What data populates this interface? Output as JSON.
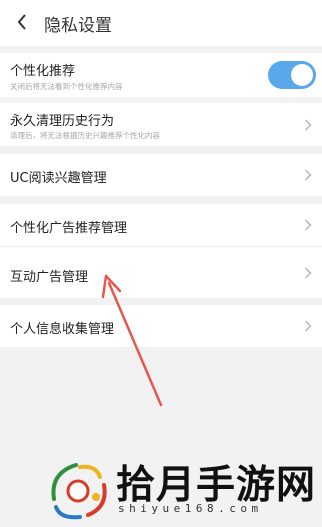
{
  "header": {
    "title": "隐私设置",
    "back_icon": "chevron-left-icon"
  },
  "settings": {
    "personalized_recommend": {
      "label": "个性化推荐",
      "description": "关闭后将无法看到个性化推荐内容",
      "toggle_on": true
    },
    "clear_history": {
      "label": "永久清理历史行为",
      "description": "清理后，将无法根据历史兴趣推荐个性化内容"
    },
    "uc_interest": {
      "label": "UC阅读兴趣管理"
    },
    "ad_recommend": {
      "label": "个性化广告推荐管理"
    },
    "interactive_ads": {
      "label": "互动广告管理"
    },
    "personal_info": {
      "label": "个人信息收集管理"
    }
  },
  "colors": {
    "toggle_accent": "#5aa8ec",
    "annotation_arrow": "#e8564f"
  },
  "watermark": {
    "name": "拾月手游网",
    "domain": "shiyue168.com"
  }
}
